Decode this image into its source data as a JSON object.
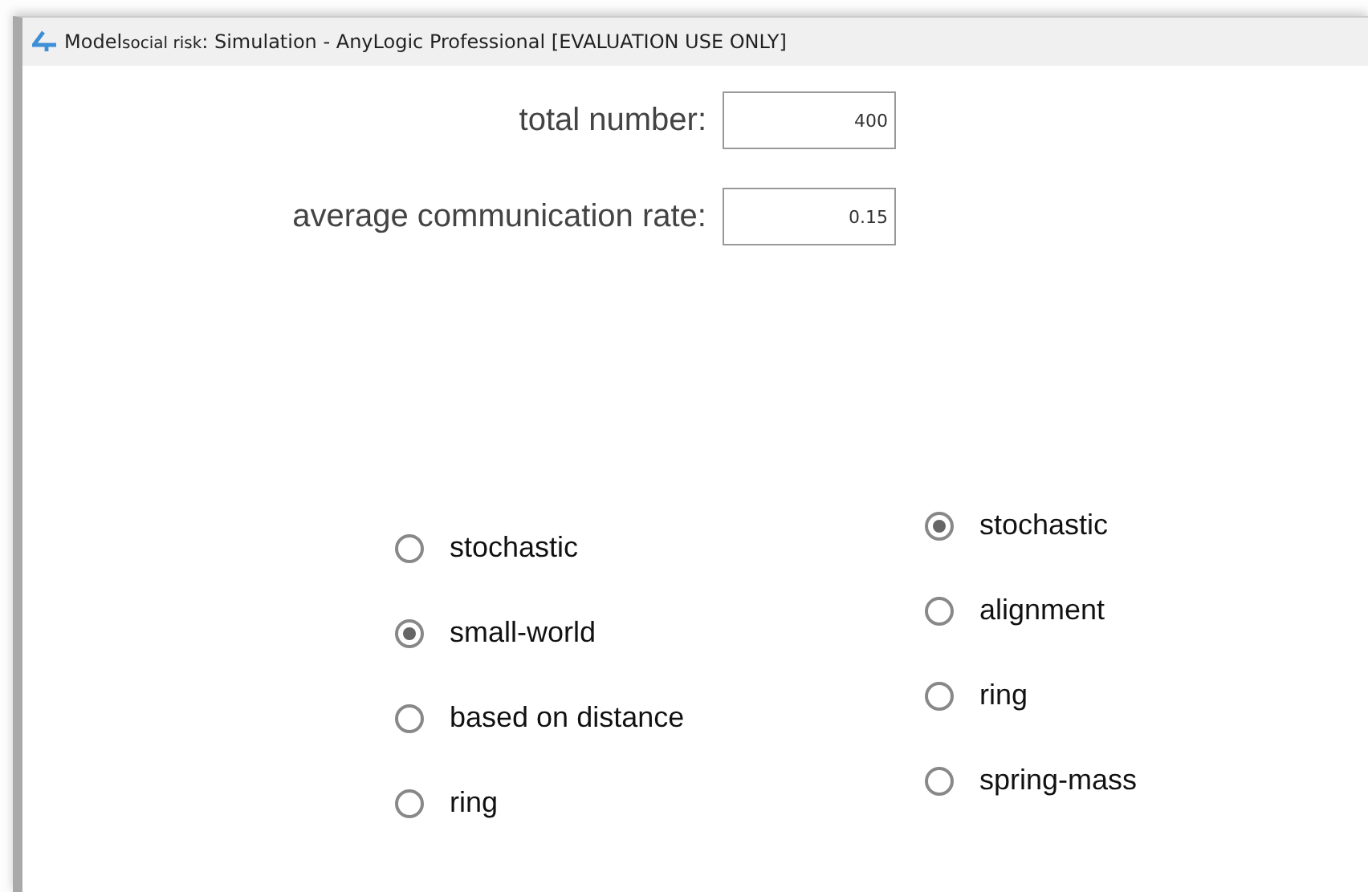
{
  "window": {
    "title_prefix": "Model",
    "model_name": "social risk",
    "title_rest": ": Simulation - AnyLogic Professional [EVALUATION USE ONLY]"
  },
  "fields": [
    {
      "label": "total number:",
      "value": "400"
    },
    {
      "label": "average communication rate:",
      "value": "0.15"
    }
  ],
  "radio_groups": [
    [
      {
        "label": "stochastic",
        "selected": false
      },
      {
        "label": "small-world",
        "selected": true
      },
      {
        "label": "based on distance",
        "selected": false
      },
      {
        "label": "ring",
        "selected": false
      }
    ],
    [
      {
        "label": "stochastic",
        "selected": true
      },
      {
        "label": "alignment",
        "selected": false
      },
      {
        "label": "ring",
        "selected": false
      },
      {
        "label": "spring-mass",
        "selected": false
      }
    ]
  ]
}
